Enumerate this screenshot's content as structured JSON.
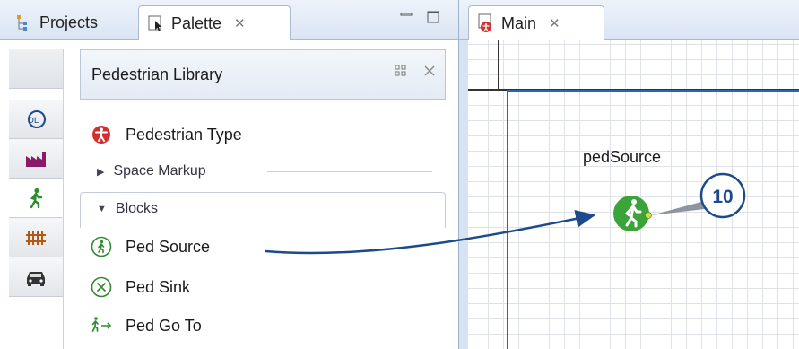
{
  "left_view": {
    "tabs": [
      {
        "label": "Projects",
        "icon": "projects-icon"
      },
      {
        "label": "Palette",
        "icon": "palette-icon",
        "close": "✕"
      }
    ]
  },
  "palette": {
    "library_title": "Pedestrian Library",
    "categories": [
      "agent-icon",
      "process-icon",
      "pedestrian-icon",
      "rail-icon",
      "road-icon"
    ],
    "items": {
      "pedestrian_type": "Pedestrian Type",
      "ped_source": "Ped Source",
      "ped_sink": "Ped Sink",
      "ped_go_to": "Ped Go To"
    },
    "sections": {
      "space_markup": "Space Markup",
      "blocks": "Blocks"
    }
  },
  "main_view": {
    "tab_label": "Main",
    "tab_close": "✕",
    "element_label": "pedSource",
    "callout_number": "10"
  },
  "colors": {
    "accent": "#1c4a8a",
    "ped_green": "#3aa33a",
    "ped_type_red": "#d32f2f",
    "frame_blue": "#2f64b3"
  }
}
